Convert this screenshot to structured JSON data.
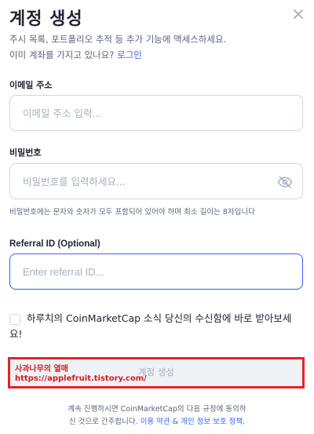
{
  "header": {
    "title": "계정 생성",
    "close_icon": "close-icon"
  },
  "intro": {
    "line1": "주시 목록, 포트폴리오 추적 등 추가 기능에 액세스하세요.",
    "line2_prefix": "이미 계좌를 가지고 있나요? ",
    "login_link": "로그인"
  },
  "email": {
    "label": "이메일 주소",
    "placeholder": "이메일 주소 입력...",
    "value": ""
  },
  "password": {
    "label": "비밀번호",
    "placeholder": "비밀번호를 입력하세요...",
    "value": "",
    "toggle_icon": "eye-off-icon",
    "hint": "비밀번호에는 문자와 숫자가 모두 포함되어 있어야 하며 최소 길이는 8자입니다"
  },
  "referral": {
    "label": "Referral ID (Optional)",
    "placeholder": "Enter referral ID...",
    "value": ""
  },
  "newsletter": {
    "checked": false,
    "label": "하루치의 CoinMarketCap 소식 당신의 수신함에 바로 받아보세요!"
  },
  "submit": {
    "label": "계정 생성"
  },
  "watermark": {
    "line1": "사과나무의 열매",
    "line2": "https://applefruit.tistory.com/"
  },
  "terms": {
    "line1": "계속 진행하시면 CoinMarketCap의 다음 규정에 동의하",
    "line2_prefix": "신 것으로 간주합니다. ",
    "terms_link": "이용 약관",
    "amp": " & ",
    "privacy_link": "개인 정보 보호 정책",
    "suffix": "."
  },
  "colors": {
    "accent": "#3861fb",
    "text": "#222531",
    "muted": "#58667e",
    "watermark_red": "#e3222b"
  }
}
